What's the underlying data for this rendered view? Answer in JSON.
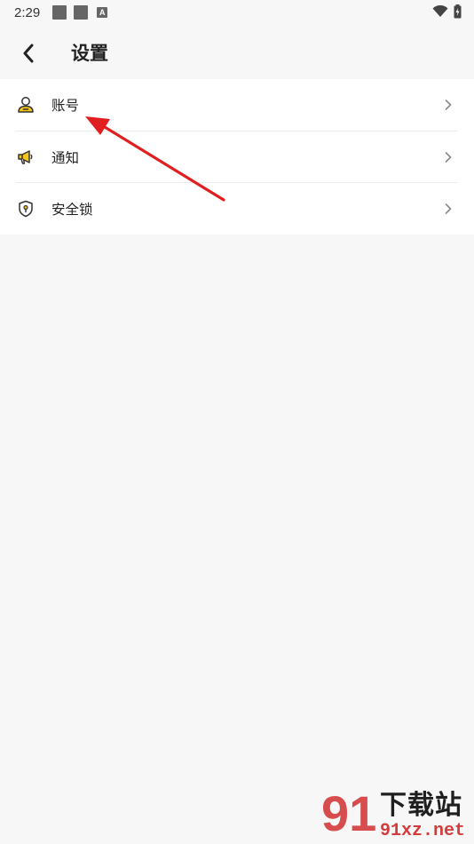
{
  "status_bar": {
    "time": "2:29",
    "notification_badge": "A"
  },
  "header": {
    "title": "设置"
  },
  "settings": {
    "items": [
      {
        "label": "账号",
        "icon": "user-icon"
      },
      {
        "label": "通知",
        "icon": "megaphone-icon"
      },
      {
        "label": "安全锁",
        "icon": "shield-lock-icon"
      }
    ]
  },
  "watermark": {
    "big_text": "91",
    "top_text": "下载站",
    "bottom_text": "91xz.net"
  },
  "colors": {
    "accent_yellow": "#f5c518",
    "annotation_red": "#e02020",
    "background": "#f7f7f7"
  }
}
